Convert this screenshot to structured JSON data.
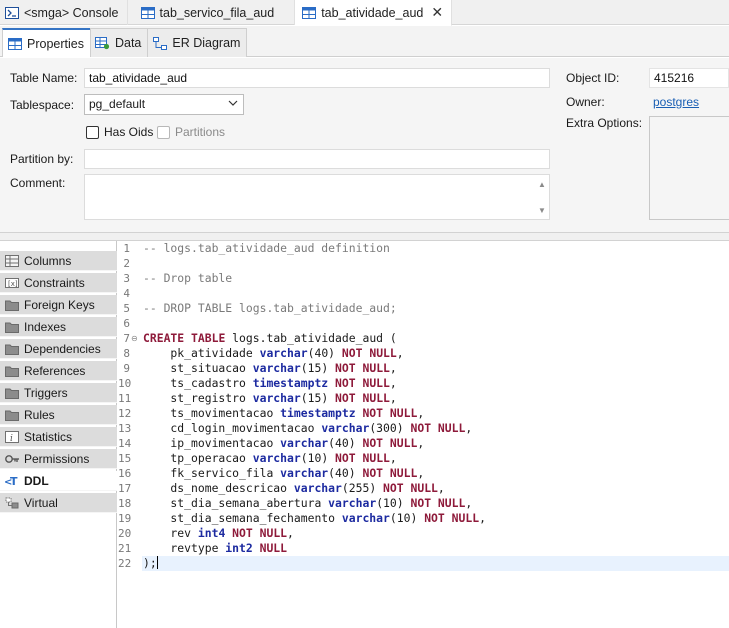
{
  "editor_tabs": [
    {
      "label": "<smga> Console",
      "icon": "console-icon",
      "active": false
    },
    {
      "label": "tab_servico_fila_aud",
      "icon": "table-icon",
      "active": false
    },
    {
      "label": "tab_atividade_aud",
      "icon": "table-icon",
      "active": true
    }
  ],
  "sub_tabs": [
    {
      "label": "Properties",
      "icon": "table-icon",
      "active": true
    },
    {
      "label": "Data",
      "icon": "data-grid-icon",
      "active": false
    },
    {
      "label": "ER Diagram",
      "icon": "er-diagram-icon",
      "active": false
    }
  ],
  "properties": {
    "table_name_label": "Table Name:",
    "table_name_value": "tab_atividade_aud",
    "tablespace_label": "Tablespace:",
    "tablespace_value": "pg_default",
    "has_oids_label": "Has Oids",
    "partitions_label": "Partitions",
    "partition_by_label": "Partition by:",
    "partition_by_value": "",
    "comment_label": "Comment:",
    "comment_value": "",
    "object_id_label": "Object ID:",
    "object_id_value": "415216",
    "owner_label": "Owner:",
    "owner_value": "postgres",
    "extra_options_label": "Extra Options:"
  },
  "left_nav": [
    {
      "label": "Columns",
      "icon": "columns-icon",
      "active": false
    },
    {
      "label": "Constraints",
      "icon": "constraints-icon",
      "active": false
    },
    {
      "label": "Foreign Keys",
      "icon": "folder-icon",
      "active": false
    },
    {
      "label": "Indexes",
      "icon": "folder-icon",
      "active": false
    },
    {
      "label": "Dependencies",
      "icon": "folder-icon",
      "active": false
    },
    {
      "label": "References",
      "icon": "folder-icon",
      "active": false
    },
    {
      "label": "Triggers",
      "icon": "folder-icon",
      "active": false
    },
    {
      "label": "Rules",
      "icon": "folder-icon",
      "active": false
    },
    {
      "label": "Statistics",
      "icon": "statistics-icon",
      "active": false
    },
    {
      "label": "Permissions",
      "icon": "key-icon",
      "active": false
    },
    {
      "label": "DDL",
      "icon": "ddl-icon",
      "active": true
    },
    {
      "label": "Virtual",
      "icon": "virtual-icon",
      "active": false
    }
  ],
  "ddl": {
    "line_numbers": [
      "1",
      "2",
      "3",
      "4",
      "5",
      "6",
      "7",
      "8",
      "9",
      "10",
      "11",
      "12",
      "13",
      "14",
      "15",
      "16",
      "17",
      "18",
      "19",
      "20",
      "21",
      "22"
    ],
    "lines": [
      "-- logs.tab_atividade_aud definition",
      "",
      "-- Drop table",
      "",
      "-- DROP TABLE logs.tab_atividade_aud;",
      "",
      "CREATE TABLE logs.tab_atividade_aud (",
      "    pk_atividade varchar(40) NOT NULL,",
      "    st_situacao varchar(15) NOT NULL,",
      "    ts_cadastro timestamptz NOT NULL,",
      "    st_registro varchar(15) NOT NULL,",
      "    ts_movimentacao timestamptz NOT NULL,",
      "    cd_login_movimentacao varchar(300) NOT NULL,",
      "    ip_movimentacao varchar(40) NOT NULL,",
      "    tp_operacao varchar(10) NOT NULL,",
      "    fk_servico_fila varchar(40) NOT NULL,",
      "    ds_nome_descricao varchar(255) NOT NULL,",
      "    st_dia_semana_abertura varchar(10) NOT NULL,",
      "    st_dia_semana_fechamento varchar(10) NOT NULL,",
      "    rev int4 NOT NULL,",
      "    revtype int2 NULL",
      ");"
    ]
  },
  "colors": {
    "keyword": "#8e1a3a",
    "type": "#1c2aa0",
    "comment": "#7a7a7a",
    "current_line": "#e8f2fe",
    "link": "#1a5fb4",
    "active_tab_accent": "#3574c4"
  }
}
